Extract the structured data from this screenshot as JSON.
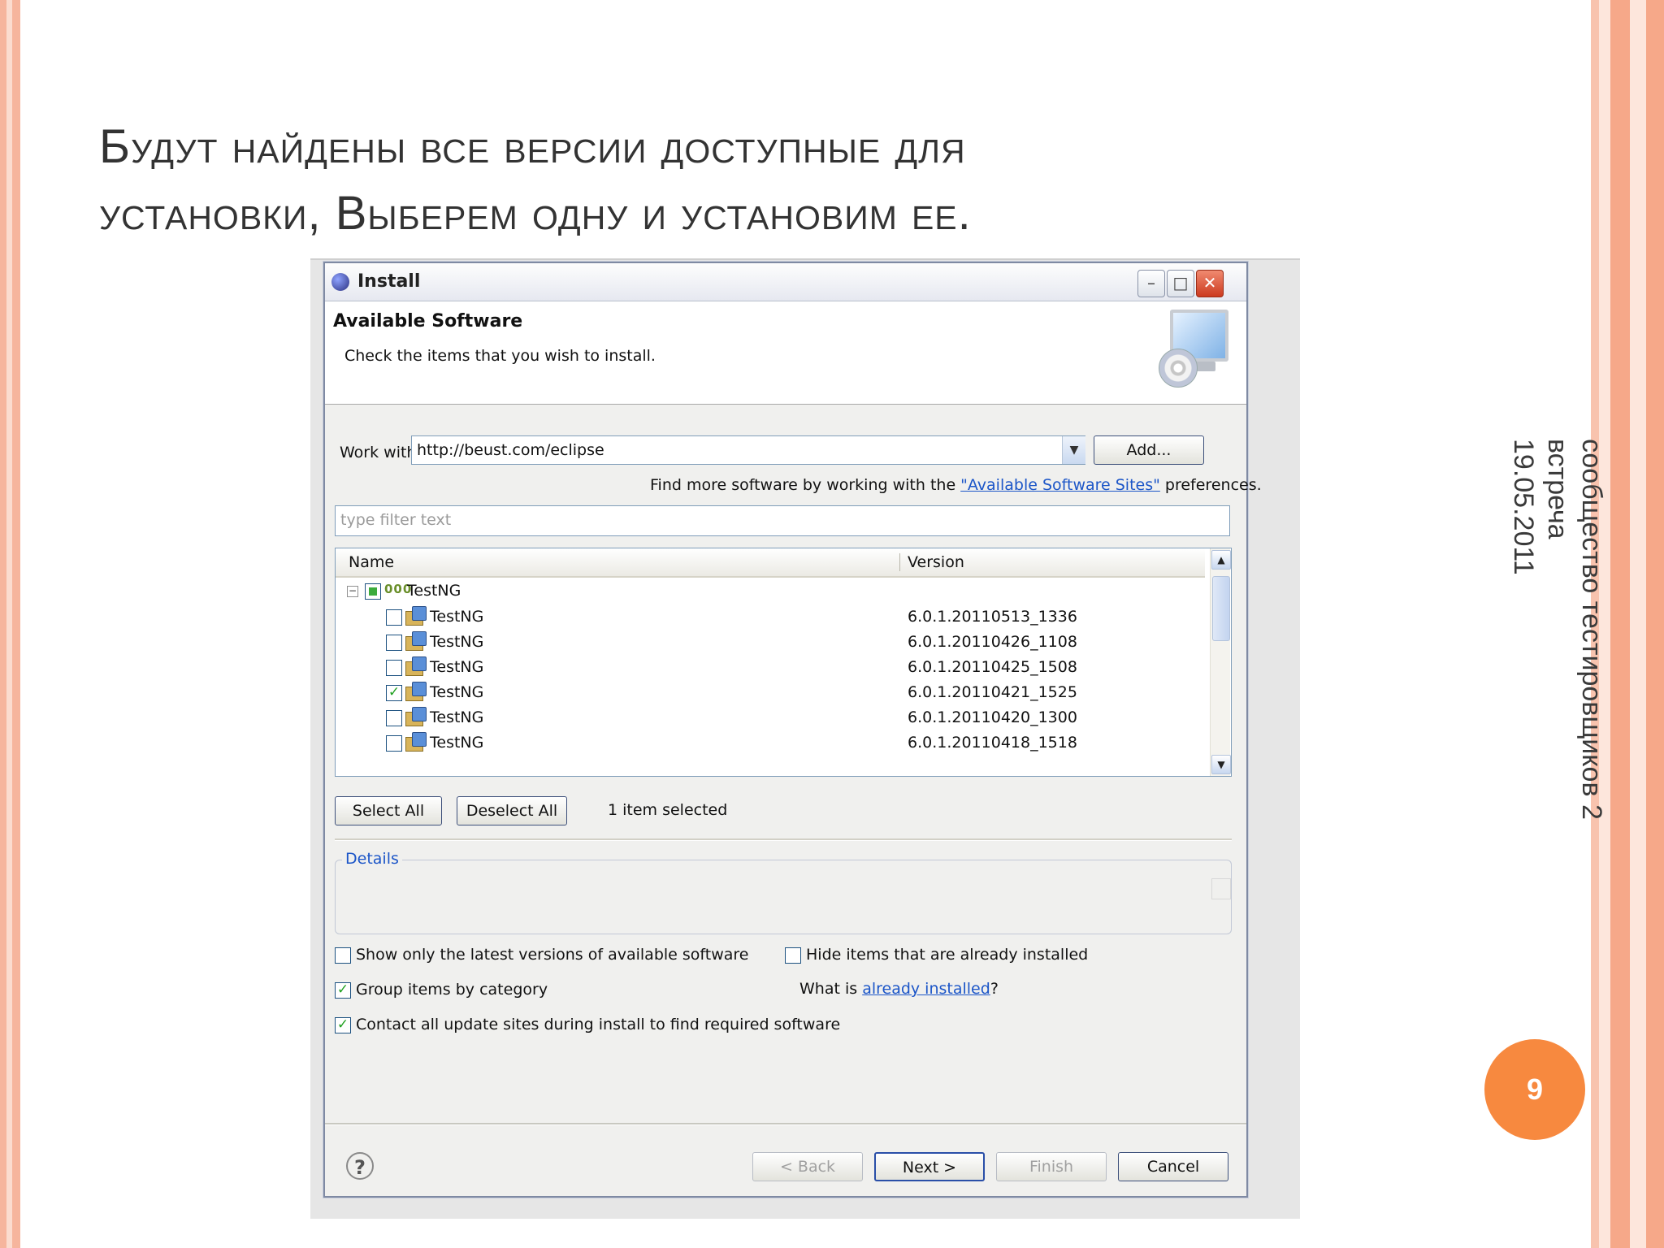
{
  "slide": {
    "title_line1": "Будут найдены все версии доступные для",
    "title_line2": "установки, Выберем одну и установим ее.",
    "side_text_1": "сообщество тестировщиков 2 встреча",
    "side_text_2": "19.05.2011",
    "page_number": "9"
  },
  "dialog": {
    "title": "Install",
    "title_icon": "eclipse-icon",
    "header_title": "Available Software",
    "header_subtitle": "Check the items that you wish to install.",
    "work_with_label": "Work with:",
    "work_with_value": "http://beust.com/eclipse",
    "add_button": "Add...",
    "find_more_prefix": "Find more software by working with the ",
    "find_more_link": "\"Available Software Sites\"",
    "find_more_suffix": " preferences.",
    "filter_placeholder": "type filter text",
    "table": {
      "columns": [
        "Name",
        "Version"
      ],
      "category": {
        "name": "TestNG",
        "icon": "category-icon",
        "checked": "partial"
      },
      "rows": [
        {
          "name": "TestNG",
          "version": "6.0.1.20110513_1336",
          "checked": false
        },
        {
          "name": "TestNG",
          "version": "6.0.1.20110426_1108",
          "checked": false
        },
        {
          "name": "TestNG",
          "version": "6.0.1.20110425_1508",
          "checked": false
        },
        {
          "name": "TestNG",
          "version": "6.0.1.20110421_1525",
          "checked": true
        },
        {
          "name": "TestNG",
          "version": "6.0.1.20110420_1300",
          "checked": false
        },
        {
          "name": "TestNG",
          "version": "6.0.1.20110418_1518",
          "checked": false
        }
      ]
    },
    "select_all": "Select All",
    "deselect_all": "Deselect All",
    "selection_status": "1 item selected",
    "details_label": "Details",
    "options": {
      "latest_versions": {
        "label": "Show only the latest versions of available software",
        "checked": false
      },
      "hide_installed": {
        "label": "Hide items that are already installed",
        "checked": false
      },
      "group_by_category": {
        "label": "Group items by category",
        "checked": true
      },
      "contact_sites": {
        "label": "Contact all update sites during install to find required software",
        "checked": true
      }
    },
    "what_is_prefix": "What is ",
    "what_is_link": "already installed",
    "what_is_suffix": "?",
    "buttons": {
      "back": "< Back",
      "next": "Next >",
      "finish": "Finish",
      "cancel": "Cancel"
    }
  }
}
